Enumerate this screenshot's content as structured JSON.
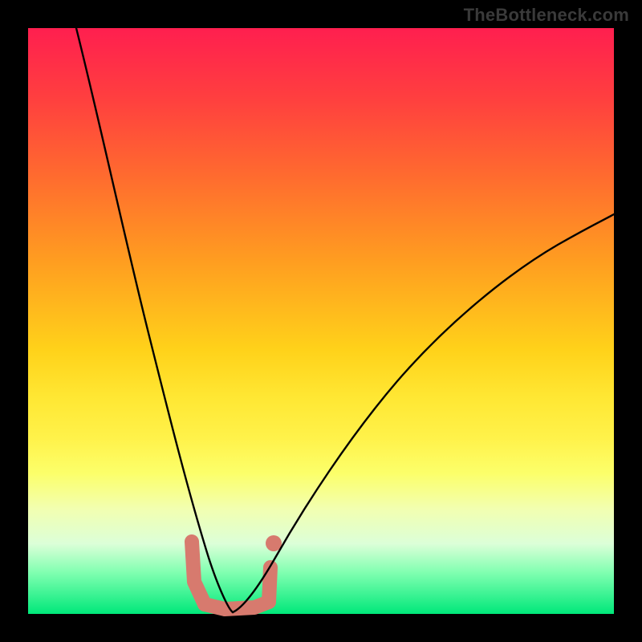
{
  "watermark": "TheBottleneck.com",
  "colors": {
    "frame_background": "#000000",
    "gradient_top": "#ff1f4f",
    "gradient_bottom": "#00e87a",
    "curve_stroke": "#000000",
    "marker_stroke": "#d77a6e"
  },
  "chart_data": {
    "type": "line",
    "title": "",
    "xlabel": "",
    "ylabel": "",
    "xlim": [
      0,
      100
    ],
    "ylim": [
      0,
      100
    ],
    "grid": false,
    "legend": false,
    "note": "Bottleneck-style V curve. Values estimated from pixel positions; minimum (best match) near x≈34.",
    "series": [
      {
        "name": "left-branch",
        "x": [
          8,
          10,
          12,
          14,
          16,
          18,
          20,
          22,
          24,
          26,
          28,
          30,
          32,
          34
        ],
        "y": [
          100,
          92,
          83,
          74,
          65,
          56,
          47,
          39,
          31,
          24,
          17,
          11,
          5,
          0
        ]
      },
      {
        "name": "right-branch",
        "x": [
          34,
          36,
          38,
          40,
          44,
          48,
          54,
          60,
          68,
          76,
          84,
          92,
          100
        ],
        "y": [
          0,
          3,
          7,
          11,
          19,
          27,
          36,
          43,
          51,
          57,
          62,
          66,
          69
        ]
      }
    ],
    "highlight_region": {
      "description": "coral U-shaped marker around the curve minimum",
      "x_range": [
        27,
        41
      ],
      "y_range": [
        0,
        12
      ]
    }
  }
}
